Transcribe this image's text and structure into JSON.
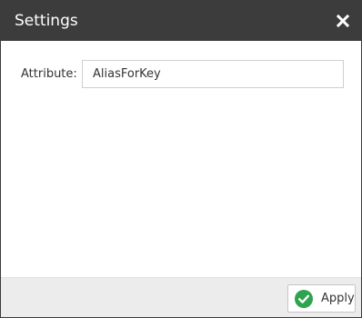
{
  "dialog": {
    "title": "Settings",
    "close_icon": "close-icon"
  },
  "form": {
    "attribute_label": "Attribute:",
    "attribute_value": "AliasForKey"
  },
  "footer": {
    "apply_label": "Apply",
    "apply_icon": "check-circle-icon"
  },
  "colors": {
    "titlebar": "#3c3c3c",
    "footer": "#ececec",
    "accent_green": "#2ea44f"
  }
}
